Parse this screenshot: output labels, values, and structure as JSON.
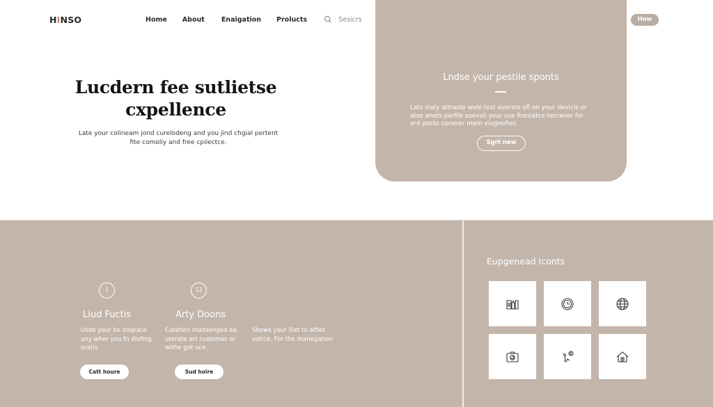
{
  "header": {
    "logo": {
      "part1": "H",
      "accent": "I",
      "part2": "NSO"
    },
    "nav": [
      {
        "label": "Home"
      },
      {
        "label": "About"
      },
      {
        "label": "Enaigation"
      },
      {
        "label": "Prolucts"
      }
    ],
    "search": {
      "icon": "search-icon",
      "label": "Sesicrs"
    },
    "cta_label": "How"
  },
  "hero": {
    "title_line1": "Lucdern fee sutlietse",
    "title_line2": "cxpellence",
    "subtitle": "Late your colineam jond curelodeng and you jind chgial pertent fite comoliy and free cpilectce."
  },
  "promo": {
    "title": "Lndse your pestile sponts",
    "text": "Lats nialy attraste wole test averste ofl on your devicis or atse anots perfils soevali your sue firesiatce tecraner for erd pocte conerer mem eiognofies.",
    "button_label": "Sgrt new"
  },
  "features": [
    {
      "number": "1",
      "title": "Liud Fuctis",
      "text": "Useb your be sospace any wher you fn diofing oratis.",
      "button_label": "Catt houre"
    },
    {
      "number": "12",
      "title": "Arty Doons",
      "text": "Catatlen madsenged ea urerate art customer or withe got uce.",
      "button_label": "Sud hoire"
    },
    {
      "text": "Shows your lliet to atfiet votice. For the manegation"
    }
  ],
  "icons_panel": {
    "title": "Eupgenead Iconts",
    "icons": [
      {
        "name": "building-icon"
      },
      {
        "name": "clock-icon"
      },
      {
        "name": "globe-icon"
      },
      {
        "name": "camera-icon"
      },
      {
        "name": "tools-icon"
      },
      {
        "name": "home-icon"
      }
    ]
  },
  "colors": {
    "brand_taupe": "#c4b5aa",
    "button_taupe": "#b9aca2",
    "logo_accent": "#c28a6a",
    "text_dark": "#141414",
    "white": "#ffffff"
  }
}
